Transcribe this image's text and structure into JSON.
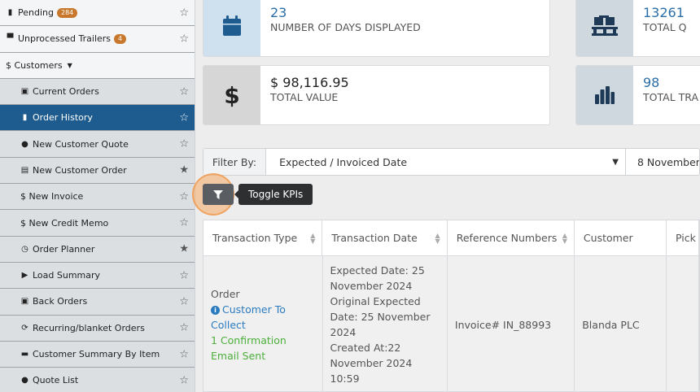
{
  "sidebar": {
    "items": [
      {
        "label": "Pending",
        "badge": "284",
        "starred": false
      },
      {
        "label": "Unprocessed Trailers",
        "badge": "4",
        "starred": false
      },
      {
        "label": "$ Customers",
        "starred": false
      },
      {
        "label": "Current Orders",
        "starred": false
      },
      {
        "label": "Order History",
        "starred": false
      },
      {
        "label": "New Customer Quote",
        "starred": false
      },
      {
        "label": "New Customer Order",
        "starred": true
      },
      {
        "label": "$ New Invoice",
        "starred": false
      },
      {
        "label": "$ New Credit Memo",
        "starred": false
      },
      {
        "label": "Order Planner",
        "starred": true
      },
      {
        "label": "Load Summary",
        "starred": false
      },
      {
        "label": "Back Orders",
        "starred": false
      },
      {
        "label": "Recurring/blanket Orders",
        "starred": false
      },
      {
        "label": "Customer Summary By Item",
        "starred": false
      },
      {
        "label": "Quote List",
        "starred": false
      }
    ]
  },
  "kpis": {
    "days": {
      "value": "23",
      "label": "NUMBER OF DAYS DISPLAYED"
    },
    "qty": {
      "value": "13261",
      "label": "TOTAL Q"
    },
    "value": {
      "value": "$ 98,116.95",
      "label": "TOTAL VALUE"
    },
    "trans": {
      "value": "98",
      "label": "TOTAL TRA"
    }
  },
  "filter": {
    "label": "Filter By:",
    "selected": "Expected / Invoiced Date",
    "date": "8 November"
  },
  "toggle": {
    "tooltip": "Toggle KPIs"
  },
  "table": {
    "headers": [
      "Transaction Type",
      "Transaction Date",
      "Reference Numbers",
      "Customer",
      "Pick"
    ],
    "row": {
      "type": "Order",
      "type_link": "Customer To Collect",
      "type_note": "1 Confirmation Email Sent",
      "date_lines": [
        "Expected Date: 25",
        "November 2024",
        "Original Expected",
        "Date: 25 November",
        "2024",
        "Created At:22",
        "November 2024",
        "10:59"
      ],
      "reference": "Invoice# IN_88993",
      "customer": "Blanda PLC"
    }
  },
  "colors": {
    "accent": "#1e5b8e",
    "badge": "#c8782c",
    "link": "#2b7bc0",
    "success": "#4caf3a"
  }
}
